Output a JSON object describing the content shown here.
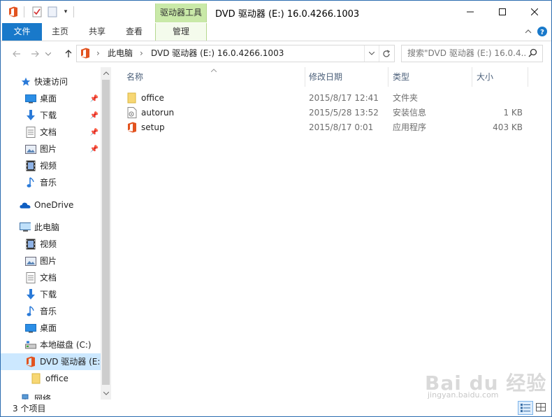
{
  "window": {
    "title": "DVD 驱动器 (E:) 16.0.4266.1003"
  },
  "titlebar": {
    "context_tab_group": "驱动器工具"
  },
  "ribbon": {
    "tabs": [
      {
        "label": "文件"
      },
      {
        "label": "主页"
      },
      {
        "label": "共享"
      },
      {
        "label": "查看"
      },
      {
        "label": "管理"
      }
    ]
  },
  "address": {
    "segments": [
      "此电脑",
      "DVD 驱动器 (E:) 16.0.4266.1003"
    ],
    "search_placeholder": "搜索\"DVD 驱动器 (E:) 16.0.4..."
  },
  "nav": {
    "quick_access": "快速访问",
    "items": [
      {
        "label": "桌面",
        "icon": "desktop-icon"
      },
      {
        "label": "下载",
        "icon": "download-icon"
      },
      {
        "label": "文档",
        "icon": "documents-icon"
      },
      {
        "label": "图片",
        "icon": "pictures-icon"
      },
      {
        "label": "视频",
        "icon": "videos-icon"
      },
      {
        "label": "音乐",
        "icon": "music-icon"
      },
      {
        "label": "OneDrive",
        "icon": "onedrive-icon"
      },
      {
        "label": "此电脑",
        "icon": "this-pc-icon"
      },
      {
        "label": "视频",
        "icon": "videos-icon"
      },
      {
        "label": "图片",
        "icon": "pictures-icon"
      },
      {
        "label": "文档",
        "icon": "documents-icon"
      },
      {
        "label": "下载",
        "icon": "download-icon"
      },
      {
        "label": "音乐",
        "icon": "music-icon"
      },
      {
        "label": "桌面",
        "icon": "desktop-icon"
      },
      {
        "label": "本地磁盘 (C:)",
        "icon": "local-disk-icon"
      },
      {
        "label": "DVD 驱动器 (E:",
        "icon": "office-dvd-icon"
      },
      {
        "label": "office",
        "icon": "folder-icon"
      },
      {
        "label": "网络",
        "icon": "network-icon"
      }
    ]
  },
  "list": {
    "columns": [
      "名称",
      "修改日期",
      "类型",
      "大小"
    ],
    "rows": [
      {
        "name": "office",
        "date": "2015/8/17 12:41",
        "type": "文件夹",
        "size": "",
        "icon": "folder-icon"
      },
      {
        "name": "autorun",
        "date": "2015/5/28 13:52",
        "type": "安装信息",
        "size": "1 KB",
        "icon": "setup-info-icon"
      },
      {
        "name": "setup",
        "date": "2015/8/17 0:01",
        "type": "应用程序",
        "size": "403 KB",
        "icon": "office-app-icon"
      }
    ]
  },
  "status": {
    "text": "3 个项目"
  },
  "watermark": {
    "brand": "Bai du 经验",
    "sub": "jingyan.baidu.com"
  },
  "colors": {
    "accent": "#1979ca",
    "context_tab": "#c9e9a8",
    "selection": "#cce8ff",
    "office": "#e2531f",
    "folder": "#f7d774"
  }
}
